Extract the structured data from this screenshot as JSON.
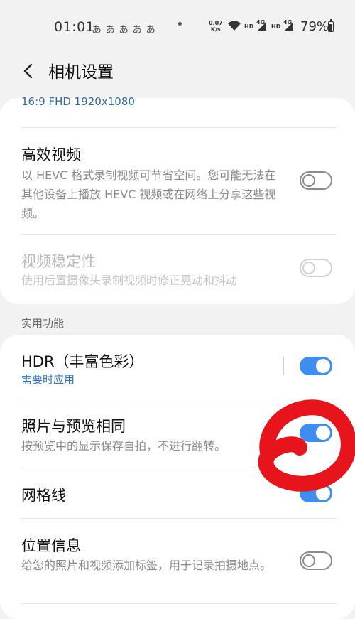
{
  "status_bar": {
    "time": "01:01",
    "notification_icons": "ぁぁぁぁぁ",
    "dot": "•",
    "net_speed_value": "0.07",
    "net_speed_unit": "K/s",
    "hd1": "HD",
    "g1": "4G",
    "hd2": "HD",
    "g2": "4G",
    "battery": "79%"
  },
  "header": {
    "title": "相机设置"
  },
  "settings": {
    "video_size_value": "16:9 FHD 1920x1080",
    "efficient_video": {
      "title": "高效视频",
      "desc": "以 HEVC 格式录制视频可节省空间。您可能无法在其他设备上播放 HEVC 视频或在网络上分享这些视频。",
      "enabled": false
    },
    "stabilization": {
      "title": "视频稳定性",
      "desc": "使用后置摄像头录制视频时修正晃动和抖动",
      "enabled": false
    }
  },
  "useful_section": {
    "label": "实用功能",
    "hdr": {
      "title": "HDR（丰富色彩）",
      "sub": "需要时应用",
      "enabled": true
    },
    "same_as_preview": {
      "title": "照片与预览相同",
      "desc": "按预览中的显示保存自拍，不进行翻转。",
      "enabled": true
    },
    "grid_lines": {
      "title": "网格线",
      "enabled": true
    },
    "location": {
      "title": "位置信息",
      "desc": "给您的照片和视频添加标签，用于记录拍摄地点。",
      "enabled": false
    }
  },
  "colors": {
    "accent": "#3e8df0",
    "link": "#2a71bd",
    "annotation": "#e8141c"
  }
}
